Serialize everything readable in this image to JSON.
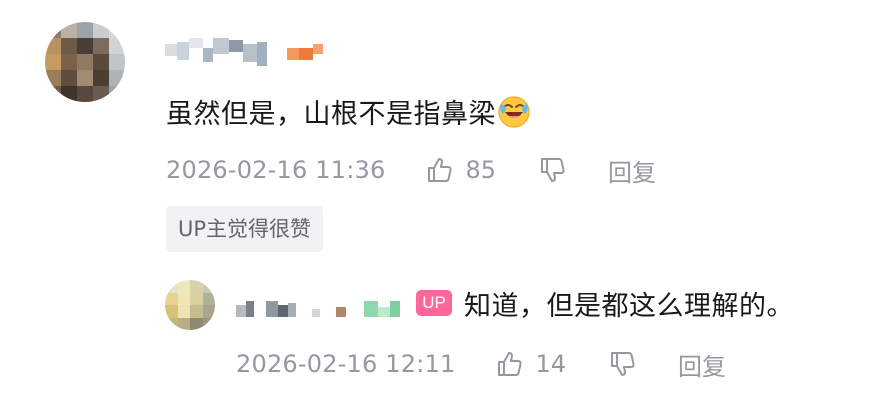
{
  "comment": {
    "author_name": "",
    "text": "虽然但是，山根不是指鼻梁",
    "emoji_icon": "laughing-crying-face",
    "time": "2026-02-16 11:36",
    "likes": "85",
    "reply_label": "回复",
    "up_liked_tag": "UP主觉得很赞"
  },
  "reply": {
    "author_name": "",
    "up_badge": "UP",
    "text": "知道，但是都这么理解的。",
    "time": "2026-02-16 12:11",
    "likes": "14",
    "reply_label": "回复"
  },
  "colors": {
    "text_primary": "#18191c",
    "text_meta": "#9499a0",
    "up_badge": "#ff6699",
    "tag_bg": "#f1f2f3"
  }
}
